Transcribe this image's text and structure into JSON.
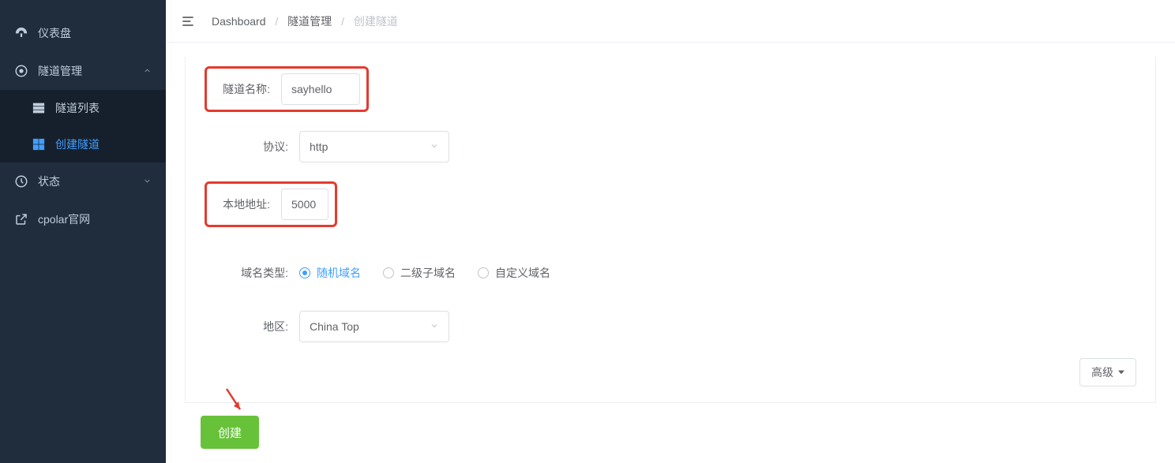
{
  "sidebar": {
    "dashboard": "仪表盘",
    "tunnel_mgmt": "隧道管理",
    "tunnel_list": "隧道列表",
    "create_tunnel": "创建隧道",
    "status": "状态",
    "cpolar_site": "cpolar官网"
  },
  "breadcrumb": {
    "a": "Dashboard",
    "b": "隧道管理",
    "c": "创建隧道"
  },
  "form": {
    "label_name": "隧道名称:",
    "value_name": "sayhello",
    "label_proto": "协议:",
    "value_proto": "http",
    "label_addr": "本地地址:",
    "value_addr": "5000",
    "label_domain_type": "域名类型:",
    "radio_random": "随机域名",
    "radio_sub": "二级子域名",
    "radio_custom": "自定义域名",
    "label_region": "地区:",
    "value_region": "China Top",
    "advanced": "高级",
    "create": "创建"
  }
}
